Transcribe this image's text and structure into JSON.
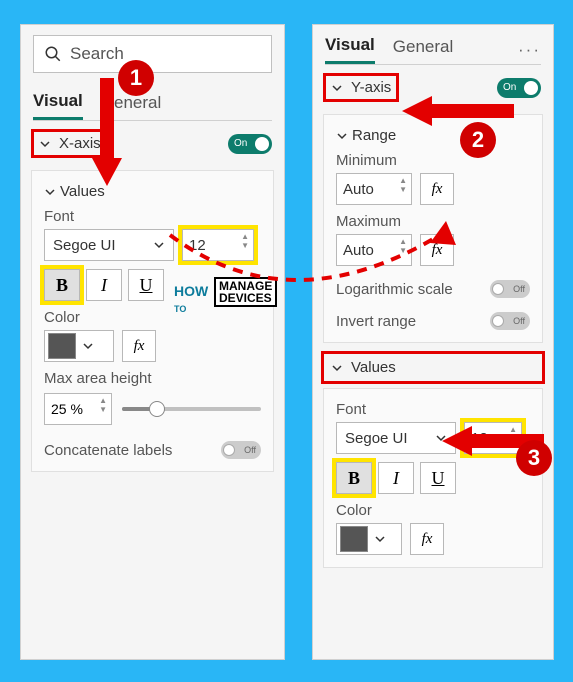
{
  "left": {
    "search_placeholder": "Search",
    "tabs": {
      "visual": "Visual",
      "general": "General"
    },
    "xaxis": {
      "label": "X-axis",
      "toggle": "On"
    },
    "values": {
      "title": "Values",
      "font_label": "Font",
      "font_name": "Segoe UI",
      "font_size": "12",
      "bold": "B",
      "italic": "I",
      "underline": "U",
      "color_label": "Color",
      "fx": "fx",
      "max_area_label": "Max area height",
      "max_area_value": "25 %",
      "concat_label": "Concatenate labels",
      "concat_toggle": "Off"
    }
  },
  "right": {
    "tabs": {
      "visual": "Visual",
      "general": "General"
    },
    "yaxis": {
      "label": "Y-axis",
      "toggle": "On"
    },
    "range": {
      "title": "Range",
      "min_label": "Minimum",
      "min_value": "Auto",
      "max_label": "Maximum",
      "max_value": "Auto",
      "log_label": "Logarithmic scale",
      "log_toggle": "Off",
      "invert_label": "Invert range",
      "invert_toggle": "Off",
      "fx": "fx"
    },
    "values": {
      "title": "Values",
      "font_label": "Font",
      "font_name": "Segoe UI",
      "font_size": "12",
      "bold": "B",
      "italic": "I",
      "underline": "U",
      "color_label": "Color",
      "fx": "fx"
    }
  },
  "badges": {
    "one": "1",
    "two": "2",
    "three": "3"
  },
  "watermark": {
    "how": "HOW",
    "to": "TO",
    "manage": "MANAGE",
    "devices": "DEVICES"
  }
}
